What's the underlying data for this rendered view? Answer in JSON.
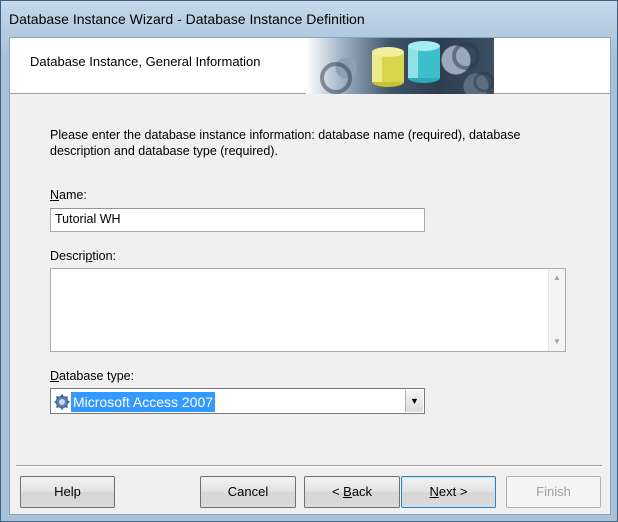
{
  "window": {
    "title": "Database Instance Wizard - Database Instance Definition"
  },
  "banner": {
    "title": "Database Instance, General Information"
  },
  "intro": "Please enter the database instance information: database name (required), database description and database type (required).",
  "name": {
    "label_pre": "N",
    "label_post": "ame:",
    "value": "Tutorial WH"
  },
  "description": {
    "label_pre": "Descri",
    "label_u": "p",
    "label_post": "tion:",
    "value": ""
  },
  "dbtype": {
    "label_u": "D",
    "label_post": "atabase type:",
    "value": "Microsoft Access 2007",
    "icon": "database-icon"
  },
  "buttons": {
    "help": "Help",
    "cancel": "Cancel",
    "back_pre": "< ",
    "back_u": "B",
    "back_post": "ack",
    "next_u": "N",
    "next_post": "ext >",
    "finish": "Finish"
  },
  "colors": {
    "selection": "#3399ff",
    "banner_bg": "#ffffff"
  }
}
